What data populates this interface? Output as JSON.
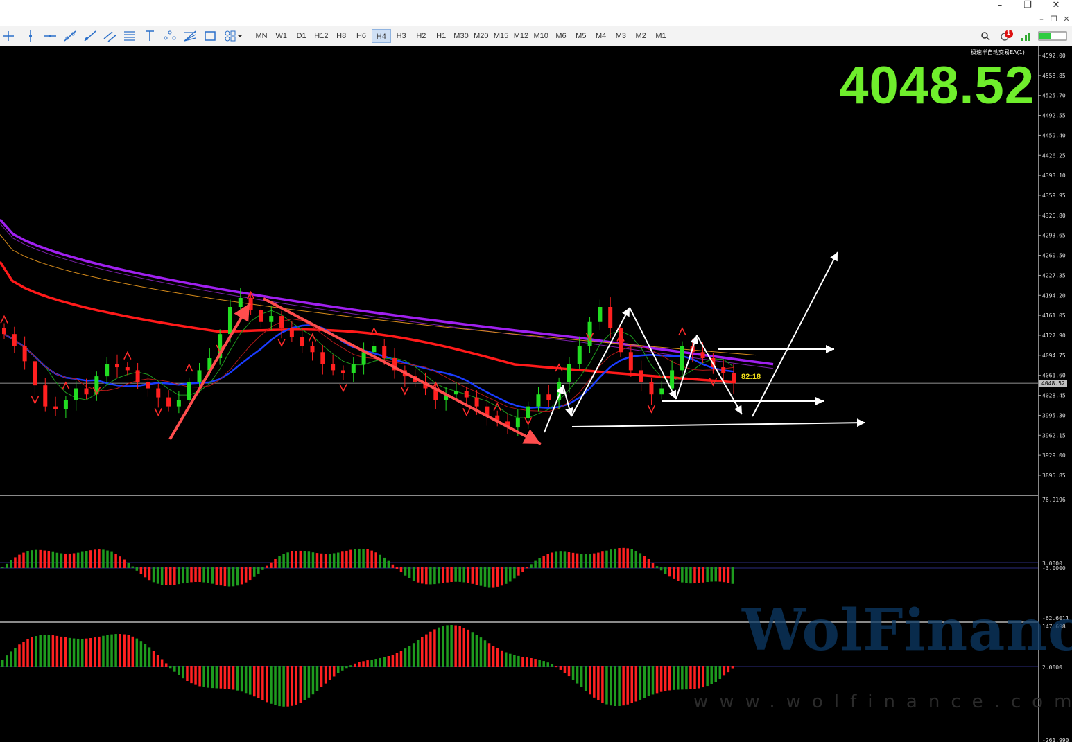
{
  "window": {
    "minimize": "–",
    "restore": "❐",
    "close": "✕",
    "sub_minimize": "–",
    "sub_restore": "❐",
    "sub_close": "✕"
  },
  "toolbar": {
    "timeframes": [
      "MN",
      "W1",
      "D1",
      "H12",
      "H8",
      "H6",
      "H4",
      "H3",
      "H2",
      "H1",
      "M30",
      "M20",
      "M15",
      "M12",
      "M10",
      "M6",
      "M5",
      "M4",
      "M3",
      "M2",
      "M1"
    ],
    "active_timeframe": "H4",
    "notification_count": "1"
  },
  "chart": {
    "current_price": "4048.52",
    "current_price_tag": "4048.52",
    "ea_label": "极速半自动交易EA(1)",
    "bar_timer": "82:18",
    "watermark": "WolFinance",
    "watermark_url": "www.wolfinance.com"
  },
  "colors": {
    "up_candle": "#22dd22",
    "down_candle": "#ff2020",
    "ma_purple": "#a020f0",
    "ma_red": "#ff1a1a",
    "ma_blue": "#1a3cff",
    "big_price": "#6fee2c"
  },
  "chart_data": {
    "type": "candlestick",
    "price_axis_ticks": [
      "4592.00",
      "4558.85",
      "4525.70",
      "4492.55",
      "4459.40",
      "4426.25",
      "4393.10",
      "4359.95",
      "4326.80",
      "4293.65",
      "4260.50",
      "4227.35",
      "4194.20",
      "4161.05",
      "4127.90",
      "4094.75",
      "4061.60",
      "4028.45",
      "3995.30",
      "3962.15",
      "3929.00",
      "3895.85"
    ],
    "oscillator1_ticks": [
      "76.9196",
      "3.0000",
      "-3.0000",
      "-62.6011"
    ],
    "oscillator2_ticks": [
      "147.698",
      "2.0000",
      "-261.990"
    ],
    "last_price": 4048.52,
    "closes": [
      4130,
      4110,
      4085,
      4045,
      4010,
      4005,
      4020,
      4040,
      4030,
      4060,
      4080,
      4075,
      4070,
      4050,
      4040,
      4025,
      4010,
      4020,
      4050,
      4070,
      4090,
      4130,
      4175,
      4190,
      4170,
      4150,
      4160,
      4140,
      4125,
      4110,
      4100,
      4080,
      4070,
      4065,
      4080,
      4100,
      4110,
      4090,
      4070,
      4060,
      4050,
      4040,
      4020,
      4030,
      4035,
      4025,
      4010,
      3995,
      3985,
      3975,
      3990,
      4010,
      4030,
      4020,
      4050,
      4080,
      4110,
      4150,
      4175,
      4140,
      4100,
      4070,
      4050,
      4030,
      4040,
      4070,
      4110,
      4100,
      4090,
      4075,
      4065,
      4048.52
    ]
  }
}
